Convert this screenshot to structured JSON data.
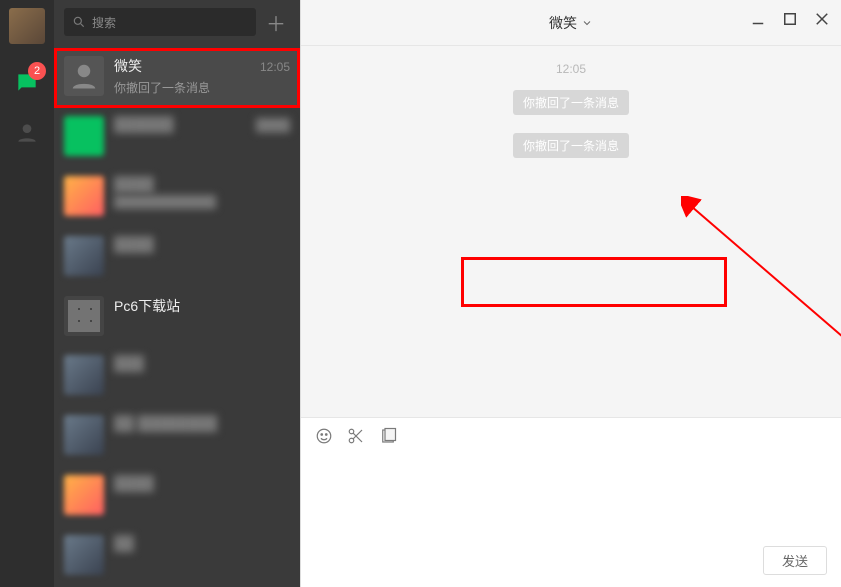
{
  "rail": {
    "badge_count": "2"
  },
  "search": {
    "placeholder": "搜索"
  },
  "conversations": [
    {
      "name": "微笑",
      "preview": "你撤回了一条消息",
      "time": "12:05",
      "active": true
    },
    {
      "name": "██████",
      "preview": "",
      "time": "████"
    },
    {
      "name": "████",
      "preview": "████████████",
      "time": ""
    },
    {
      "name": "████",
      "preview": "",
      "time": ""
    },
    {
      "name": "Pc6下载站",
      "preview": "",
      "time": ""
    },
    {
      "name": "███",
      "preview": "",
      "time": ""
    },
    {
      "name": "██ ████████",
      "preview": "",
      "time": ""
    },
    {
      "name": "████",
      "preview": "",
      "time": ""
    },
    {
      "name": "██",
      "preview": "",
      "time": ""
    }
  ],
  "chat": {
    "title": "微笑",
    "timestamp": "12:05",
    "recall_msg_1": "你撤回了一条消息",
    "recall_msg_2": "你撤回了一条消息"
  },
  "composer": {
    "send_label": "发送"
  }
}
